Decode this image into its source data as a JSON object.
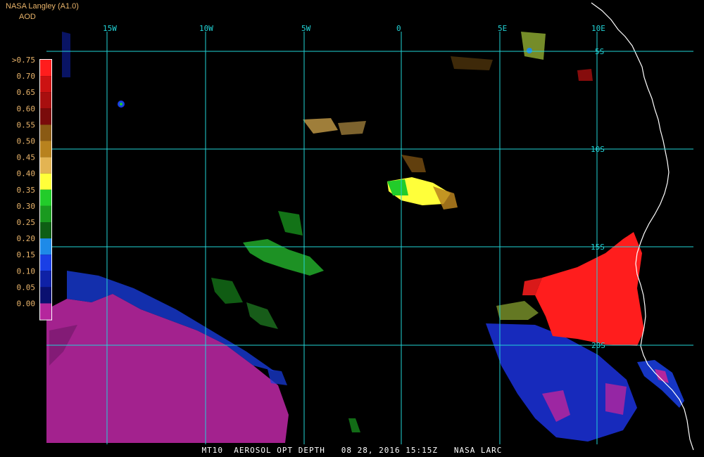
{
  "header": {
    "title": "NASA Langley (A1.0)",
    "subtitle": "AOD"
  },
  "footer": {
    "caption": "MT10  AEROSOL OPT DEPTH   08 28, 2016 15:15Z   NASA LARC"
  },
  "grid": {
    "longitudes": [
      "15W",
      "10W",
      "5W",
      "0",
      "5E",
      "10E"
    ],
    "latitudes": [
      "5S",
      "10S",
      "15S",
      "20S"
    ]
  },
  "legend": {
    "title": "AOD",
    "ticks": [
      ">0.75",
      "0.70",
      "0.65",
      "0.60",
      "0.55",
      "0.50",
      "0.45",
      "0.40",
      "0.35",
      "0.30",
      "0.25",
      "0.20",
      "0.15",
      "0.10",
      "0.05",
      "0.00"
    ],
    "colors": [
      "#ff1d1d",
      "#cc1212",
      "#a80f0f",
      "#7a0b0b",
      "#8a5a14",
      "#b8821e",
      "#e3b453",
      "#ffff3a",
      "#22cc2a",
      "#1a9a1f",
      "#0e5e14",
      "#1e8ae8",
      "#1a3fe6",
      "#0f21a6",
      "#0a1070",
      "#b5269d"
    ]
  },
  "colors": {
    "grid": "#22d3d6",
    "label": "#22d3d6",
    "coast": "#ffffff",
    "header": "#e8b36a"
  }
}
